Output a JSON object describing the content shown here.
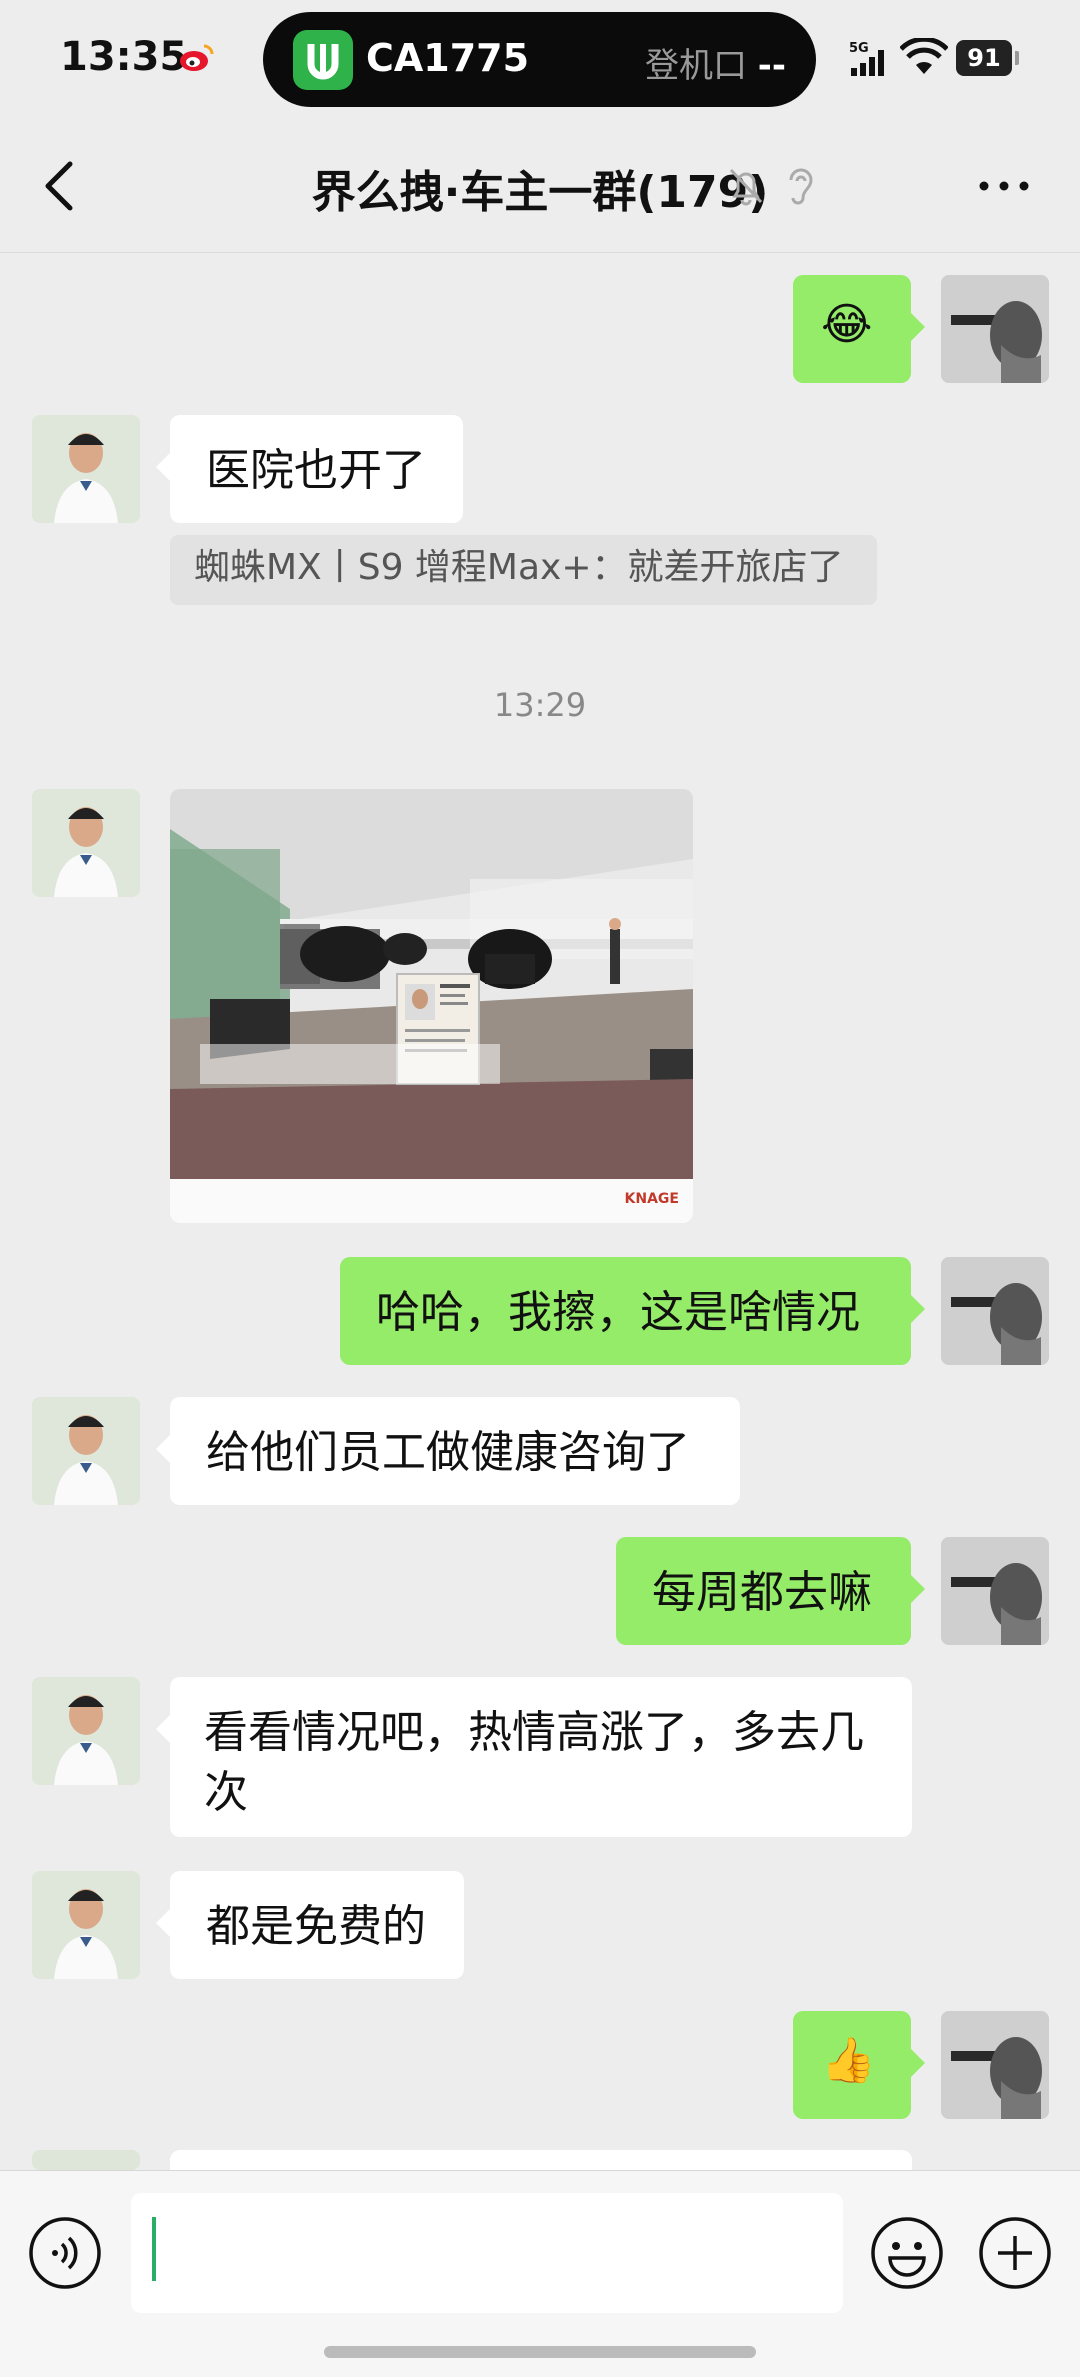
{
  "status": {
    "time": "13:35",
    "flight": "CA1775",
    "gate_label": "登机口",
    "gate_value": "--",
    "network": "5G",
    "battery": "91"
  },
  "nav": {
    "title": "界么拽·车主一群(179)"
  },
  "messages": {
    "m1_emoji": "😂",
    "m2_text": "医院也开了",
    "m2_quote": "蜘蛛MX丨S9 增程Max+：就差开旅店了",
    "timestamp": "13:29",
    "m3_image_brand": "KNAGE",
    "m4_text": "哈哈，我擦，这是啥情况",
    "m5_text": "给他们员工做健康咨询了",
    "m6_text": "每周都去嘛",
    "m7_text": "看看情况吧，热情高涨了，多去几次",
    "m8_text": "都是免费的",
    "m9_emoji": "👍"
  },
  "input": {
    "value": ""
  },
  "colors": {
    "outgoing_bubble": "#95ec69",
    "incoming_bubble": "#ffffff",
    "background": "#ededed",
    "caret": "#2aae67"
  }
}
